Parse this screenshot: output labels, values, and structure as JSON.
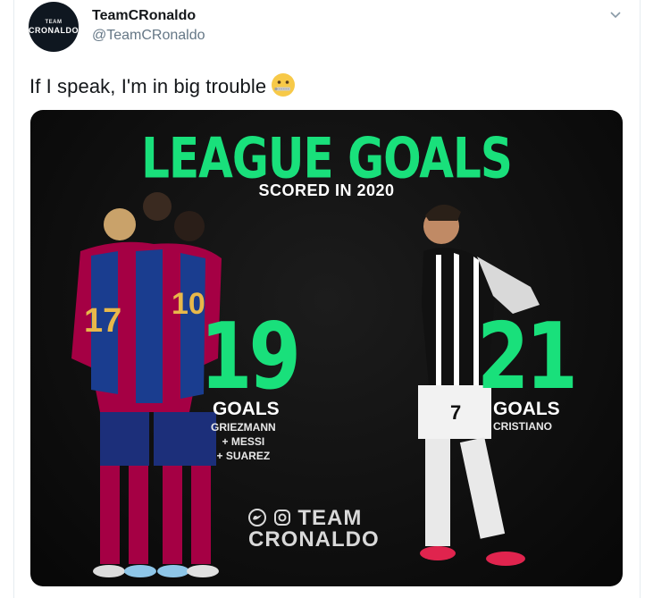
{
  "tweet": {
    "display_name": "TeamCRonaldo",
    "handle": "@TeamCRonaldo",
    "text": "If I speak, I'm in big trouble",
    "emoji": "zipper-mouth-face"
  },
  "avatar": {
    "line1": "TEAM",
    "line2": "CRONALDO"
  },
  "media": {
    "title": "LEAGUE GOALS",
    "subtitle": "SCORED IN 2020",
    "left": {
      "number": "19",
      "goals_label": "GOALS",
      "names": [
        "GRIEZMANN",
        "+ MESSI",
        "+ SUAREZ"
      ]
    },
    "right": {
      "number": "21",
      "goals_label": "GOALS",
      "names": [
        "CRISTIANO"
      ]
    },
    "logo": {
      "line1": "TEAM",
      "line2": "CRONALDO"
    }
  },
  "colors": {
    "accent_green": "#19e07b",
    "background": "#0d0d0d"
  }
}
